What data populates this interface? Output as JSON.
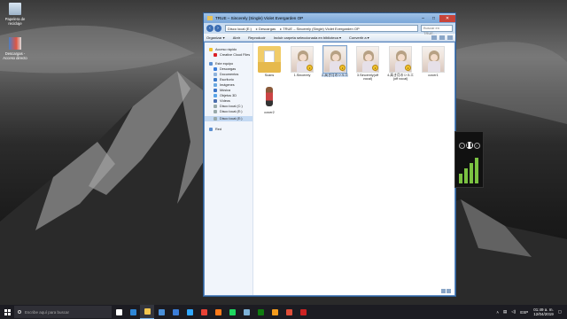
{
  "desktop": {
    "icons": [
      {
        "label": "Papelera de reciclaje",
        "icon": "recycle-bin-icon"
      },
      {
        "label": "Descargas - Acceso directo",
        "icon": "shortcut-icon"
      }
    ]
  },
  "window": {
    "title": "TRUE – Sincerely (Single) Violet Evergarden OP",
    "buttons": {
      "minimize": "–",
      "maximize": "□",
      "close": "✕"
    },
    "address": [
      "Disco local (E:)",
      "Descargas",
      "TRUE – Sincerely (Single) Violet Evergarden OP"
    ],
    "search_placeholder": "Buscar en TRUE…",
    "toolbar": [
      "Organizar ▾",
      "Abrir",
      "Reproducir",
      "Incluir carpeta seleccionada en biblioteca ▾",
      "Convertir a ▾"
    ],
    "nav": {
      "favorites": {
        "header": "Acceso rápido",
        "items": [
          "Creative Cloud Files"
        ]
      },
      "this_pc": {
        "header": "Este equipo",
        "items": [
          "Descargas",
          "Documentos",
          "Escritorio",
          "Imágenes",
          "Música",
          "Objetos 3D",
          "Vídeos",
          "Disco local (C:)",
          "Disco local (E:)"
        ]
      },
      "selected": "Disco local (E:)",
      "network": {
        "header": "Red"
      }
    },
    "files": [
      {
        "name": "Scans",
        "kind": "folder"
      },
      {
        "name": "1.Sincerely",
        "kind": "audio",
        "badge": "♪"
      },
      {
        "name": "2.高き月のシルエ",
        "kind": "audio",
        "badge": "♪"
      },
      {
        "name": "3.Sincerely(off vocal)",
        "kind": "audio",
        "badge": "♪"
      },
      {
        "name": "4.高き月のシルエ(off vocal)",
        "kind": "audio",
        "badge": "♪"
      },
      {
        "name": "cover1",
        "kind": "image"
      },
      {
        "name": "cover2",
        "kind": "image"
      }
    ]
  },
  "media_widget": {
    "play": "❚❚",
    "next": "›",
    "prev": "‹",
    "levels": [
      0.35,
      0.55,
      0.75,
      0.95
    ]
  },
  "taskbar": {
    "search_placeholder": "Escribe aquí para buscar",
    "apps": [
      {
        "icon": "task-view-icon",
        "color": "#ffffff"
      },
      {
        "icon": "edge-icon",
        "color": "#2f87d6"
      },
      {
        "icon": "file-explorer-icon",
        "color": "#f2c64f"
      },
      {
        "icon": "store-icon",
        "color": "#4a90d9"
      },
      {
        "icon": "mail-icon",
        "color": "#3b7dd8"
      },
      {
        "icon": "photoshop-icon",
        "color": "#31a8ff"
      },
      {
        "icon": "chrome-icon",
        "color": "#e84235"
      },
      {
        "icon": "firefox-icon",
        "color": "#ff7a1a"
      },
      {
        "icon": "spotify-icon",
        "color": "#1ed760"
      },
      {
        "icon": "steam-icon",
        "color": "#7eb2d8"
      },
      {
        "icon": "xbox-icon",
        "color": "#107c10"
      },
      {
        "icon": "media-player-icon",
        "color": "#f49b1c"
      },
      {
        "icon": "app-icon",
        "color": "#e04e39"
      },
      {
        "icon": "app-icon",
        "color": "#c22"
      }
    ],
    "tray": {
      "lang": "ESP",
      "time": "01:49 a. m.",
      "date": "12/04/2019"
    }
  }
}
